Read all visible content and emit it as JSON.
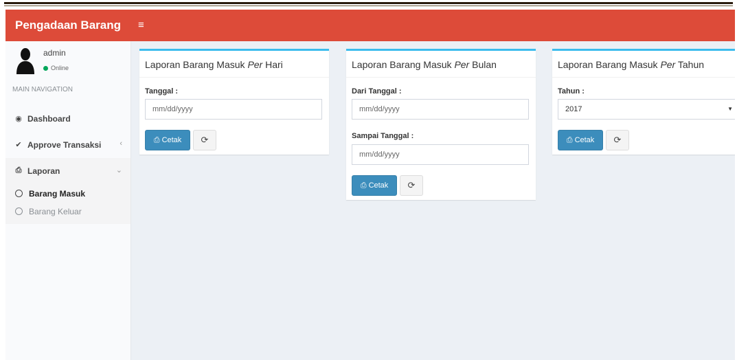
{
  "header": {
    "logo": "Pengadaan Barang",
    "menu_icon": "≡"
  },
  "user": {
    "name": "admin",
    "status": "Online"
  },
  "sidebar": {
    "nav_header": "MAIN NAVIGATION",
    "items": [
      {
        "label": "Dashboard",
        "icon": "dashboard-icon"
      },
      {
        "label": "Approve Transaksi",
        "icon": "check-icon"
      },
      {
        "label": "Laporan",
        "icon": "print-icon"
      }
    ],
    "subitems": [
      {
        "label": "Barang Masuk"
      },
      {
        "label": "Barang Keluar"
      }
    ]
  },
  "boxes": [
    {
      "title_a": "Laporan Barang Masuk ",
      "title_em": "Per",
      "title_b": " Hari",
      "label1": "Tanggal :",
      "input1": "mm/dd/yyyy",
      "cetak": "Cetak"
    },
    {
      "title_a": "Laporan Barang Masuk ",
      "title_em": "Per",
      "title_b": " Bulan",
      "label1": "Dari Tanggal :",
      "input1": "mm/dd/yyyy",
      "label2": "Sampai Tanggal :",
      "input2": "mm/dd/yyyy",
      "cetak": "Cetak"
    },
    {
      "title_a": "Laporan Barang Masuk ",
      "title_em": "Per",
      "title_b": " Tahun",
      "label1": "Tahun :",
      "select1": "2017",
      "cetak": "Cetak"
    }
  ],
  "colors": {
    "header": "#dd4b39",
    "box_border": "#3cbced",
    "button": "#3c8dbc",
    "online": "#00a65a"
  }
}
